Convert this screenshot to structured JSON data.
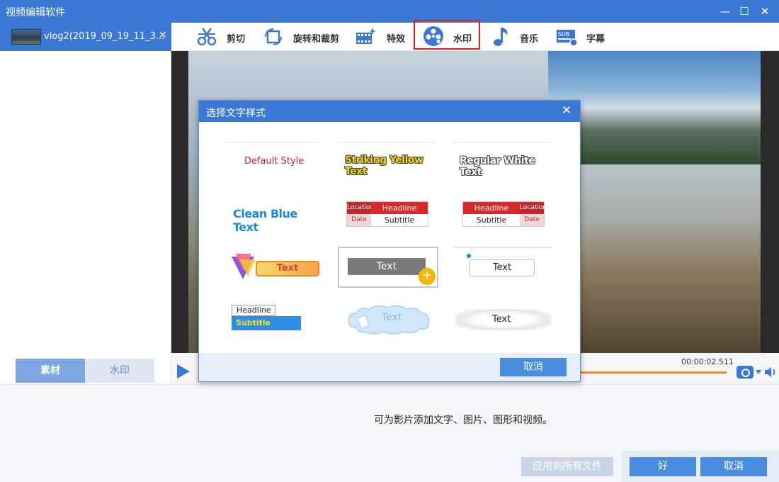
{
  "window": {
    "title": "视频编辑软件",
    "controls": {
      "minimize": "—",
      "maximize": "☐",
      "close": "✕"
    }
  },
  "file_tab": {
    "name": "vlog2(2019_09_19_11_3...",
    "close": "✕"
  },
  "left_tabs": [
    {
      "label": "素材"
    },
    {
      "label": "水印"
    }
  ],
  "toolbar": {
    "items": [
      {
        "label": "剪切",
        "icon": "scissors-icon"
      },
      {
        "label": "旋转和裁剪",
        "icon": "crop-rotate-icon"
      },
      {
        "label": "特效",
        "icon": "effects-icon"
      },
      {
        "label": "水印",
        "icon": "watermark-icon",
        "active": true
      },
      {
        "label": "音乐",
        "icon": "music-icon"
      },
      {
        "label": "字幕",
        "icon": "subtitle-icon"
      }
    ],
    "subtitle_icon_text": "SUB"
  },
  "player": {
    "timecode": "00:00:02.511"
  },
  "bottom": {
    "info": "可为影片添加文字、图片、图形和视频。",
    "apply_all": "应用到所有文件",
    "ok": "好",
    "cancel": "取消"
  },
  "dialog": {
    "title": "选择文字样式",
    "close": "✕",
    "cancel": "取消",
    "styles": {
      "default": "Default Style",
      "striking_yellow": "Striking Yellow Text",
      "regular_white": "Regular White Text",
      "clean_blue": "Clean Blue Text",
      "news_left": {
        "location": "Location",
        "headline": "Headline",
        "date": "Date",
        "subtitle": "Subtitle"
      },
      "news_right": {
        "headline": "Headline",
        "location": "Location",
        "subtitle": "Subtitle",
        "date": "Date"
      },
      "badge_text": "Text",
      "gray_box_text": "Text",
      "plus": "+",
      "white_box_text": "Text",
      "headline_subtitle": {
        "headline": "Headline",
        "subtitle": "Subtitle"
      },
      "cloud_text": "Text",
      "brush_text": "Text"
    }
  },
  "colors": {
    "primary": "#3a78d4",
    "button": "#4a8ce0",
    "highlight": "#e02020",
    "progress": "#f08a1c"
  }
}
